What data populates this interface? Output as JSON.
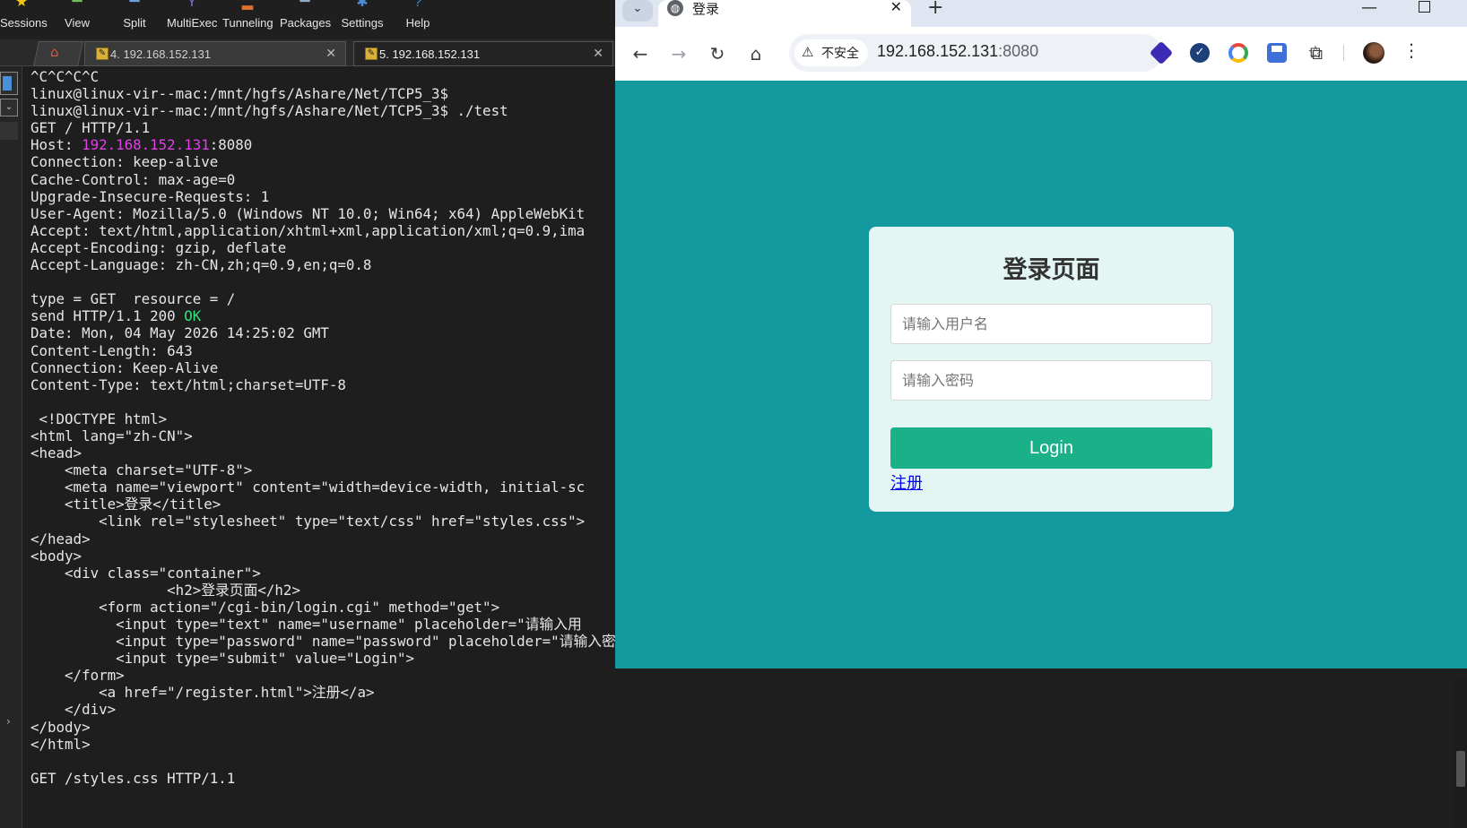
{
  "toolbar": {
    "items": [
      {
        "label": "Sessions",
        "icon": "star-icon"
      },
      {
        "label": "View",
        "icon": "monitor-icon"
      },
      {
        "label": "Split",
        "icon": "split-icon"
      },
      {
        "label": "MultiExec",
        "icon": "multiexec-icon"
      },
      {
        "label": "Tunneling",
        "icon": "tunneling-icon"
      },
      {
        "label": "Packages",
        "icon": "packages-icon"
      },
      {
        "label": "Settings",
        "icon": "gear-icon"
      },
      {
        "label": "Help",
        "icon": "help-icon"
      }
    ]
  },
  "terminal_tabs": [
    {
      "label": "4. 192.168.152.131",
      "active": false
    },
    {
      "label": "5. 192.168.152.131",
      "active": true
    }
  ],
  "terminal": {
    "lines": [
      "^C^C^C^C",
      "linux@linux-vir--mac:/mnt/hgfs/Ashare/Net/TCP5_3$",
      "linux@linux-vir--mac:/mnt/hgfs/Ashare/Net/TCP5_3$ ./test",
      "GET / HTTP/1.1",
      "Host: 192.168.152.131:8080",
      "Connection: keep-alive",
      "Cache-Control: max-age=0",
      "Upgrade-Insecure-Requests: 1",
      "User-Agent: Mozilla/5.0 (Windows NT 10.0; Win64; x64) AppleWebKit",
      "Accept: text/html,application/xhtml+xml,application/xml;q=0.9,ima",
      "Accept-Encoding: gzip, deflate",
      "Accept-Language: zh-CN,zh;q=0.9,en;q=0.8",
      "",
      "type = GET  resource = /",
      "send HTTP/1.1 200 OK",
      "Date: Mon, 04 May 2026 14:25:02 GMT",
      "Content-Length: 643",
      "Connection: Keep-Alive",
      "Content-Type: text/html;charset=UTF-8",
      "",
      " <!DOCTYPE html>",
      "<html lang=\"zh-CN\">",
      "<head>",
      "    <meta charset=\"UTF-8\">",
      "    <meta name=\"viewport\" content=\"width=device-width, initial-sc",
      "    <title>登录</title>",
      "        <link rel=\"stylesheet\" type=\"text/css\" href=\"styles.css\">",
      "</head>",
      "<body>",
      "    <div class=\"container\">",
      "                <h2>登录页面</h2>",
      "        <form action=\"/cgi-bin/login.cgi\" method=\"get\">",
      "          <input type=\"text\" name=\"username\" placeholder=\"请输入用",
      "          <input type=\"password\" name=\"password\" placeholder=\"请输入密码\"><br>",
      "          <input type=\"submit\" value=\"Login\">",
      "    </form>",
      "        <a href=\"/register.html\">注册</a>",
      "    </div>",
      "</body>",
      "</html>",
      "",
      "GET /styles.css HTTP/1.1"
    ],
    "host_prefix": "Host: ",
    "host_ip": "192.168.152.131",
    "host_port": ":8080",
    "status_prefix": "send HTTP/1.1 200 ",
    "status_ok": "OK",
    "colors": {
      "foreground": "#e6e6e6",
      "ip": "#e040e8",
      "ok": "#33e07a",
      "background": "#1e1e1e"
    }
  },
  "browser": {
    "tab_title": "登录",
    "new_tab": "+",
    "tab_close": "✕",
    "security_label": "不安全",
    "url_host": "192.168.152.131",
    "url_port": ":8080",
    "page": {
      "title": "登录页面",
      "username_placeholder": "请输入用户名",
      "password_placeholder": "请输入密码",
      "login_label": "Login",
      "register_link": "注册",
      "colors": {
        "background": "#13999e",
        "card": "#e3f6f3",
        "button": "#1ab188"
      }
    }
  }
}
